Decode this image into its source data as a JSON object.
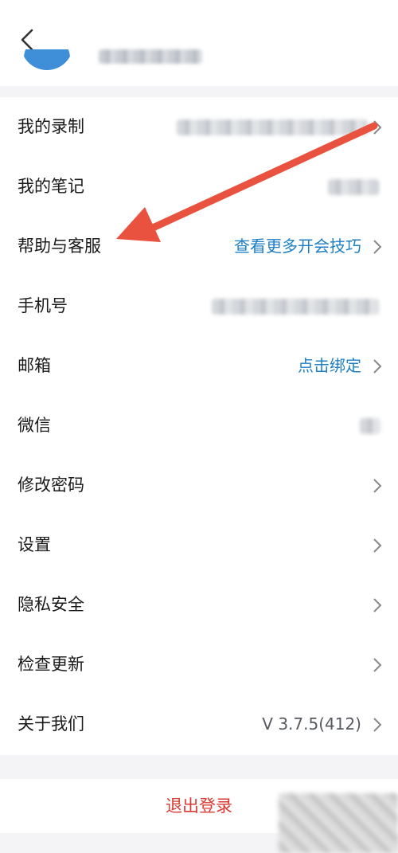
{
  "menu": {
    "items": [
      {
        "label": "我的录制",
        "value": "",
        "blurred": true
      },
      {
        "label": "我的笔记",
        "value": "",
        "blurred": true
      },
      {
        "label": "帮助与客服",
        "value": "查看更多开会技巧"
      },
      {
        "label": "手机号",
        "value": "",
        "blurred": true
      },
      {
        "label": "邮箱",
        "value": "点击绑定"
      },
      {
        "label": "微信",
        "value": "",
        "blurred": true
      },
      {
        "label": "修改密码",
        "value": ""
      },
      {
        "label": "设置",
        "value": ""
      },
      {
        "label": "隐私安全",
        "value": ""
      },
      {
        "label": "检查更新",
        "value": ""
      },
      {
        "label": "关于我们",
        "value": "V 3.7.5(412)"
      }
    ]
  },
  "logout": {
    "label": "退出登录"
  },
  "colors": {
    "link": "#1d7fc4",
    "danger": "#d93a32",
    "annotation_arrow": "#e8523e",
    "avatar": "#3f8fd8"
  },
  "icons": {
    "back": "chevron-left-icon",
    "row_chevron": "chevron-right-icon"
  }
}
